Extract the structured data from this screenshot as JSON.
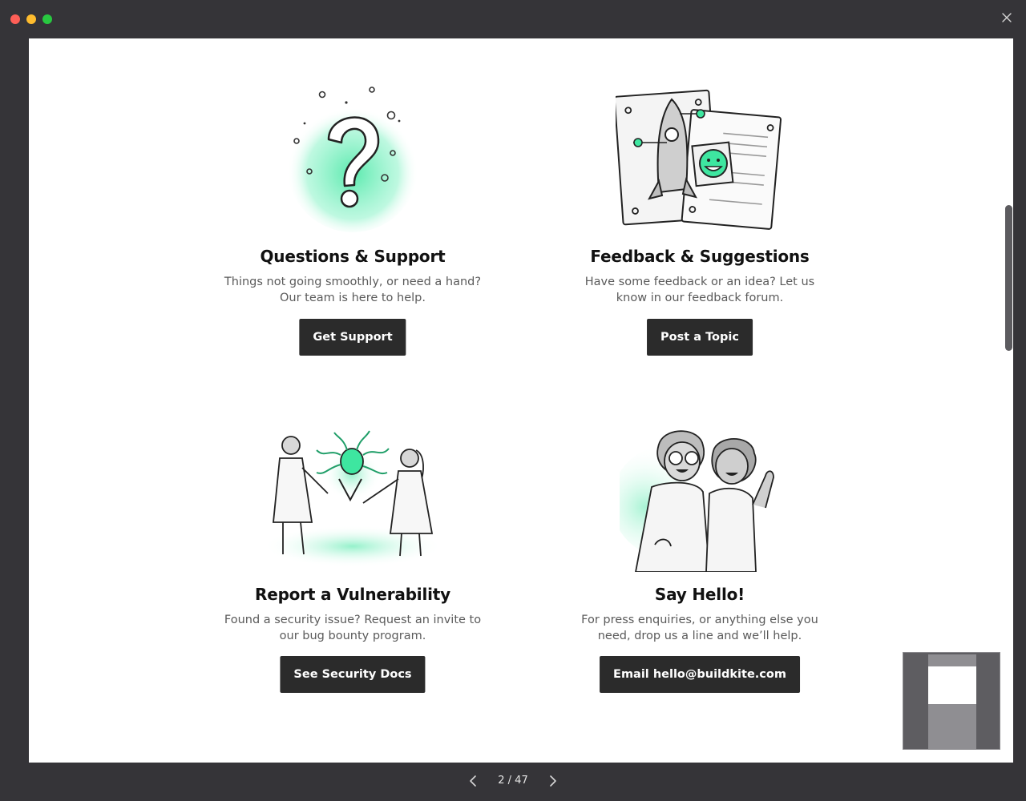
{
  "window": {
    "buttons": [
      "close",
      "minimize",
      "zoom"
    ]
  },
  "cards": [
    {
      "title": "Questions & Support",
      "desc_line1": "Things not going smoothly, or need a hand?",
      "desc_line2": "Our team is here to help.",
      "button": "Get Support",
      "illustration": "question-mark-illustration"
    },
    {
      "title": "Feedback & Suggestions",
      "desc_line1": "Have some feedback or an idea? Let us",
      "desc_line2": "know in our feedback forum.",
      "button": "Post a Topic",
      "illustration": "rocket-documents-illustration"
    },
    {
      "title": "Report a Vulnerability",
      "desc_line1": "Found a security issue? Request an invite to",
      "desc_line2": "our bug bounty program.",
      "button": "See Security Docs",
      "illustration": "scientists-bug-illustration"
    },
    {
      "title": "Say Hello!",
      "desc_line1": "For press enquiries, or anything else you",
      "desc_line2": "need, drop us a line and we’ll help.",
      "button": "Email hello@buildkite.com",
      "illustration": "waving-people-illustration"
    }
  ],
  "pager": {
    "current": "2",
    "total": "47",
    "label": "2 / 47"
  },
  "colors": {
    "accent_green": "#3ee6a0",
    "button_bg": "#2b2b2b",
    "chrome_bg": "#353438"
  },
  "icons": {
    "prev": "chevron-left-icon",
    "next": "chevron-right-icon",
    "close": "close-icon"
  }
}
